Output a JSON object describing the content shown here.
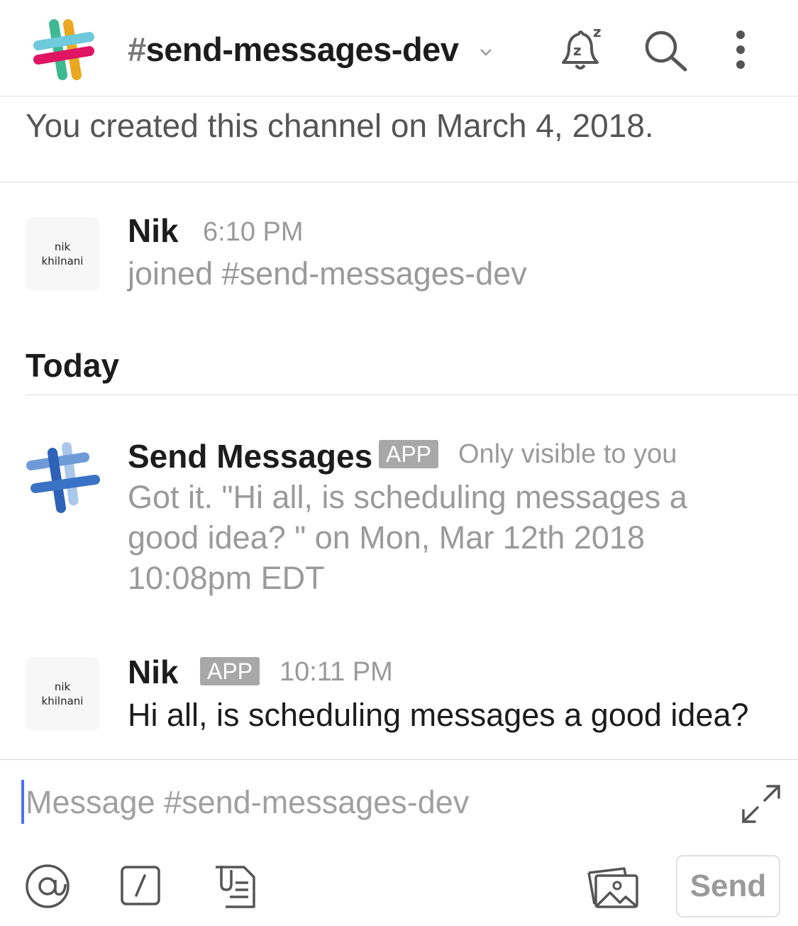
{
  "header": {
    "hash": "#",
    "channel_name": "send-messages-dev"
  },
  "channel_created_text": "You created this channel on March 4, 2018.",
  "messages": [
    {
      "sender": "Nik",
      "avatar_line1": "nik",
      "avatar_line2": "khilnani",
      "time": "6:10 PM",
      "text": "joined #send-messages-dev"
    },
    {
      "sender": "Send Messages",
      "badge": "APP",
      "visibility": "Only visible to you",
      "text": "Got it. \"Hi all, is scheduling messages a good idea? \" on Mon, Mar 12th 2018 10:08pm EDT"
    },
    {
      "sender": "Nik",
      "avatar_line1": "nik",
      "avatar_line2": "khilnani",
      "badge": "APP",
      "time": "10:11 PM",
      "text": "Hi all, is scheduling messages a good idea?"
    }
  ],
  "date_divider": "Today",
  "composer": {
    "placeholder": "Message #send-messages-dev",
    "send_label": "Send"
  },
  "icons": [
    "slack-logo",
    "chevron-down-icon",
    "snooze-bell-icon",
    "search-icon",
    "more-vertical-icon",
    "expand-icon",
    "at-mention-icon",
    "slash-command-icon",
    "file-icon",
    "image-icon"
  ],
  "colors": {
    "caret": "#4a72f5",
    "badge": "#a8a8a8",
    "muted_text": "#9a9a9a"
  }
}
